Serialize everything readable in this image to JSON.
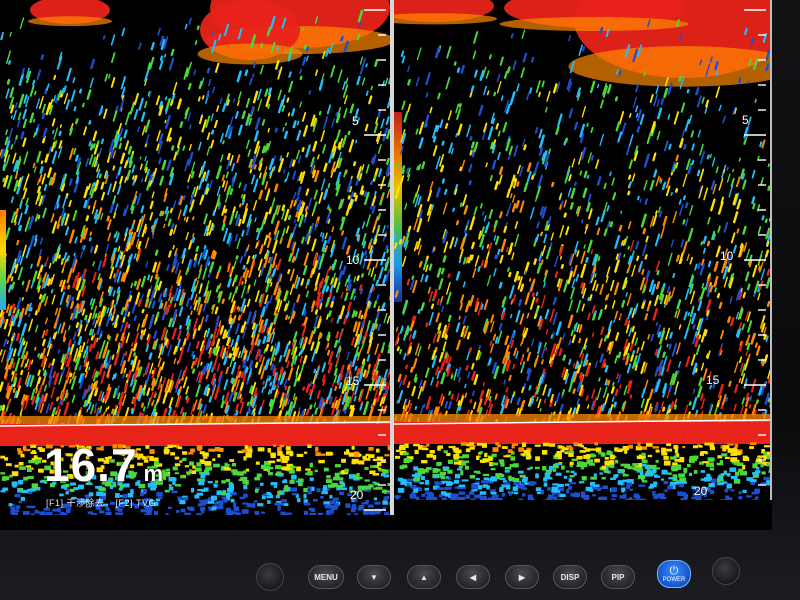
{
  "depth": {
    "value": "16.7",
    "unit": "m"
  },
  "function_keys": [
    {
      "label": "[F1] 干渉除去"
    },
    {
      "label": "[F2] TVG"
    }
  ],
  "left_scale": [
    "5",
    "10",
    "15",
    "20"
  ],
  "right_scale": [
    "5",
    "10",
    "15",
    "20"
  ],
  "buttons": [
    {
      "name": "menu-button",
      "label": "MENU"
    },
    {
      "name": "down-arrow-button",
      "label": "▼"
    },
    {
      "name": "up-arrow-button",
      "label": "▲"
    },
    {
      "name": "left-arrow-button",
      "label": "◀"
    },
    {
      "name": "right-arrow-button",
      "label": "▶"
    },
    {
      "name": "disp-button",
      "label": "DISP"
    },
    {
      "name": "pip-button",
      "label": "PIP"
    }
  ],
  "power": {
    "glyph": "⏻",
    "label": "POWER"
  },
  "colors": {
    "strong_echo": "#e8231a",
    "orange_echo": "#ff8a00",
    "yellow_echo": "#ffe000",
    "green_echo": "#4ad93a",
    "cyan_echo": "#22bfff",
    "weak_echo": "#1d4fd0",
    "power_blue": "#1f6fe8"
  }
}
